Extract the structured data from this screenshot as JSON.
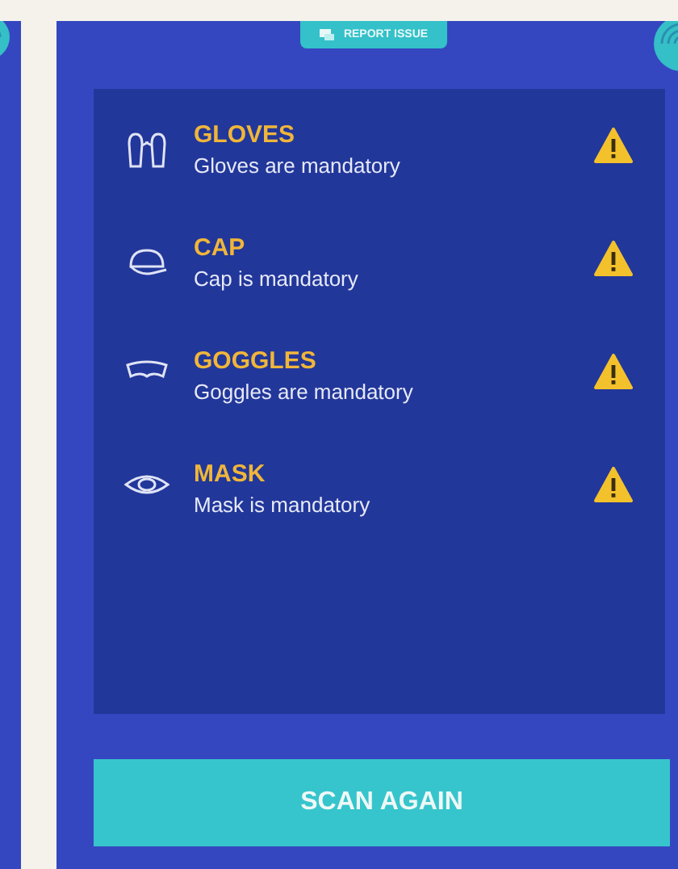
{
  "report_button": {
    "label": "REPORT ISSUE"
  },
  "items": [
    {
      "title": "GLOVES",
      "message": "Gloves are mandatory",
      "kind": "warning"
    },
    {
      "title": "CAP",
      "message": "Cap is mandatory",
      "kind": "warning"
    },
    {
      "title": "GOGGLES",
      "message": "Goggles are mandatory",
      "kind": "warning"
    },
    {
      "title": "MASK",
      "message": "Mask is mandatory",
      "kind": "warning"
    }
  ],
  "scan_button": {
    "label": "SCAN AGAIN"
  }
}
